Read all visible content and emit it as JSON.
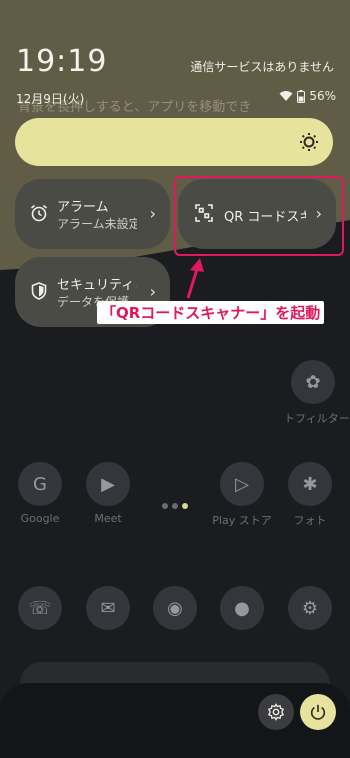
{
  "status": {
    "time": "19:19",
    "date": "12月9日(火)",
    "carrier": "通信サービスはありません",
    "battery": "56%"
  },
  "background": {
    "hint_text": "背景を長押しすると、アプリを移動でき",
    "apps_row1": [
      {
        "label": "Google",
        "icon": "google-folder-icon"
      },
      {
        "label": "Meet",
        "icon": "meet-icon"
      },
      {
        "label": "Play ストア",
        "icon": "play-store-icon"
      },
      {
        "label": "フォト",
        "icon": "photos-icon"
      }
    ],
    "extra_app_label": "トフィルター"
  },
  "tiles": [
    {
      "title": "アラーム",
      "subtitle": "アラーム未設定",
      "icon": "alarm-icon"
    },
    {
      "title": "QR コードスキャナー",
      "subtitle": "",
      "icon": "qr-scan-icon"
    },
    {
      "title": "セキュリティと",
      "subtitle": "データを保護",
      "icon": "shield-icon"
    }
  ],
  "callout": "「QRコードスキャナー」を起動",
  "colors": {
    "accent": "#e6e39c",
    "annotation": "#e0195c"
  }
}
